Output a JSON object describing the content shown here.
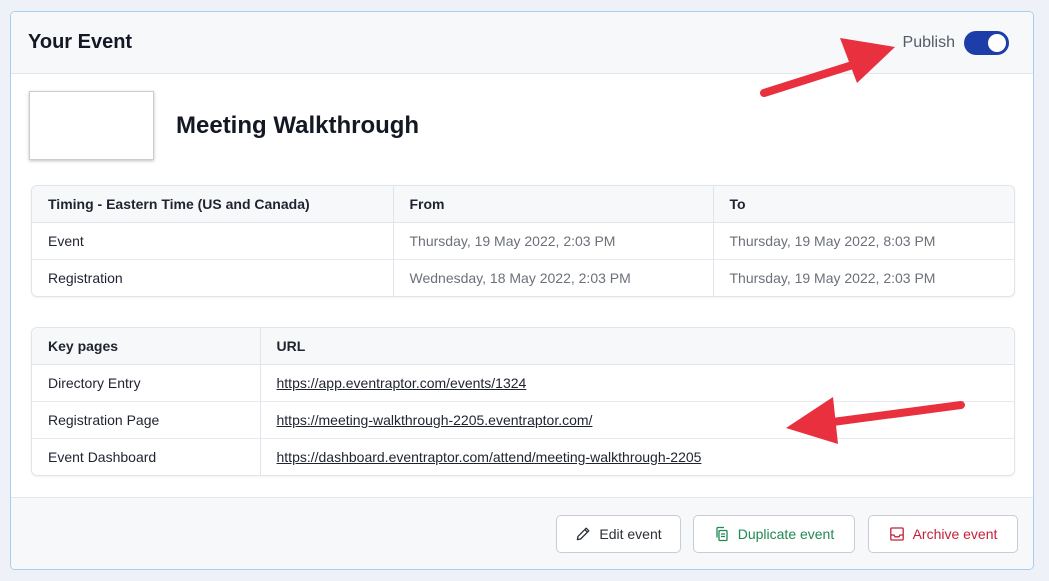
{
  "card": {
    "title": "Your Event",
    "publish_label": "Publish",
    "publish_on": true
  },
  "event": {
    "title": "Meeting Walkthrough"
  },
  "timing": {
    "headers": [
      "Timing - Eastern Time (US and Canada)",
      "From",
      "To"
    ],
    "rows": [
      [
        "Event",
        "Thursday, 19 May 2022, 2:03 PM",
        "Thursday, 19 May 2022, 8:03 PM"
      ],
      [
        "Registration",
        "Wednesday, 18 May 2022, 2:03 PM",
        "Thursday, 19 May 2022, 2:03 PM"
      ]
    ]
  },
  "key_pages": {
    "headers": [
      "Key pages",
      "URL"
    ],
    "rows": [
      [
        "Directory Entry",
        "https://app.eventraptor.com/events/1324"
      ],
      [
        "Registration Page",
        "https://meeting-walkthrough-2205.eventraptor.com/"
      ],
      [
        "Event Dashboard",
        "https://dashboard.eventraptor.com/attend/meeting-walkthrough-2205"
      ]
    ]
  },
  "footer": {
    "edit_label": "Edit event",
    "duplicate_label": "Duplicate event",
    "archive_label": "Archive event"
  },
  "colors": {
    "toggle": "#1d3ea8",
    "annotation_arrow": "#e8303f",
    "duplicate": "#1f8a52",
    "archive": "#c4213a"
  }
}
